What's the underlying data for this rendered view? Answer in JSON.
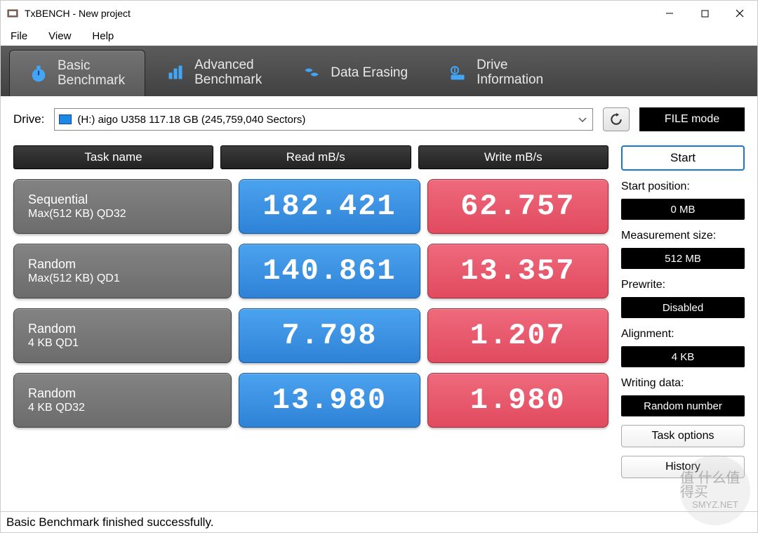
{
  "window": {
    "title": "TxBENCH - New project"
  },
  "menu": {
    "file": "File",
    "view": "View",
    "help": "Help"
  },
  "tabs": [
    {
      "line1": "Basic",
      "line2": "Benchmark",
      "active": true
    },
    {
      "line1": "Advanced",
      "line2": "Benchmark",
      "active": false
    },
    {
      "line1": "Data Erasing",
      "line2": "",
      "active": false
    },
    {
      "line1": "Drive",
      "line2": "Information",
      "active": false
    }
  ],
  "drive": {
    "label": "Drive:",
    "selected": "(H:) aigo U358  117.18 GB (245,759,040 Sectors)",
    "file_mode": "FILE mode"
  },
  "headers": {
    "task": "Task name",
    "read": "Read mB/s",
    "write": "Write mB/s"
  },
  "rows": [
    {
      "name": "Sequential",
      "sub": "Max(512 KB) QD32",
      "read": "182.421",
      "write": "62.757"
    },
    {
      "name": "Random",
      "sub": "Max(512 KB) QD1",
      "read": "140.861",
      "write": "13.357"
    },
    {
      "name": "Random",
      "sub": "4 KB QD1",
      "read": "7.798",
      "write": "1.207"
    },
    {
      "name": "Random",
      "sub": "4 KB QD32",
      "read": "13.980",
      "write": "1.980"
    }
  ],
  "side": {
    "start": "Start",
    "start_pos_label": "Start position:",
    "start_pos_value": "0 MB",
    "meas_size_label": "Measurement size:",
    "meas_size_value": "512 MB",
    "prewrite_label": "Prewrite:",
    "prewrite_value": "Disabled",
    "alignment_label": "Alignment:",
    "alignment_value": "4 KB",
    "writing_label": "Writing data:",
    "writing_value": "Random number",
    "task_options": "Task options",
    "history": "History"
  },
  "status": "Basic Benchmark finished successfully.",
  "watermark": {
    "site": "SMYZ.NET"
  }
}
